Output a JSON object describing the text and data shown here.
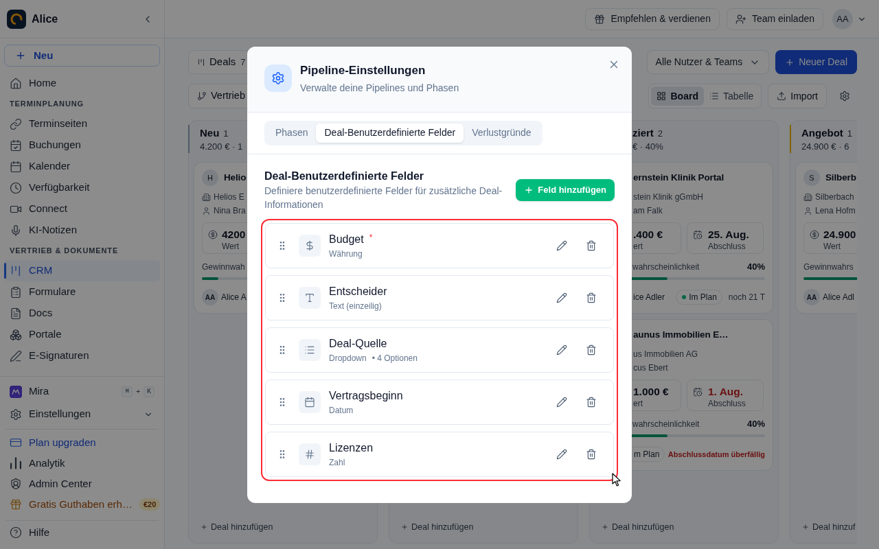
{
  "sidebar": {
    "workspace": "Alice",
    "new_button": "Neu",
    "top_items": [
      {
        "label": "Home",
        "selected": false
      }
    ],
    "sections": [
      {
        "title": "TERMINPLANUNG",
        "items": [
          {
            "label": "Terminseiten",
            "selected": false
          },
          {
            "label": "Buchungen",
            "selected": false
          },
          {
            "label": "Kalender",
            "selected": false
          },
          {
            "label": "Verfügbarkeit",
            "selected": false
          },
          {
            "label": "Connect",
            "selected": false
          },
          {
            "label": "KI-Notizen",
            "selected": false
          }
        ]
      },
      {
        "title": "VERTRIEB & DOKUMENTE",
        "items": [
          {
            "label": "CRM",
            "selected": true
          },
          {
            "label": "Formulare",
            "selected": false
          },
          {
            "label": "Docs",
            "selected": false
          },
          {
            "label": "Portale",
            "selected": false
          },
          {
            "label": "E-Signaturen",
            "selected": false
          }
        ]
      }
    ],
    "assistant": {
      "label": "Mira",
      "shortcut_keys": [
        "⌘",
        "K"
      ],
      "shortcut_joiner": "+"
    },
    "settings": {
      "label": "Einstellungen",
      "expanded": false
    },
    "footer_items": [
      {
        "kind": "upgrade",
        "label": "Plan upgraden",
        "selected": false
      },
      {
        "kind": "link",
        "label": "Analytik",
        "selected": false
      },
      {
        "kind": "link",
        "label": "Admin Center",
        "selected": false
      },
      {
        "kind": "promo",
        "label": "Gratis Guthaben erh…",
        "badge": "€20",
        "selected": false
      }
    ],
    "help": "Hilfe"
  },
  "topbar": {
    "buttons": [
      "Empfehlen & verdienen",
      "Team einladen"
    ],
    "avatar": "AA"
  },
  "toolbar": {
    "view": {
      "label": "Deals",
      "count": "7"
    },
    "pipeline": "Vertrieb",
    "owner_filter": "Alle Nutzer & Teams",
    "new_deal": "Neuer Deal",
    "view_modes": [
      {
        "label": "Board",
        "selected": true
      },
      {
        "label": "Tabelle",
        "selected": false
      }
    ],
    "import": "Import"
  },
  "board": {
    "columns": [
      {
        "title": "Neu",
        "count": "1",
        "summary": "4.200 € · 1",
        "color": "#515a65",
        "cards": [
          {
            "avatar": "H",
            "title": "Helio",
            "company": "Helios E",
            "contact": "Nina Bra",
            "value": "4200",
            "value_label": "Wert",
            "probability_label": "Gewinnwah",
            "level": 0.1,
            "owner_initials": "AA",
            "owner": "Alice A"
          }
        ],
        "add_label": "Deal hinzufügen"
      },
      {
        "add_label": "Deal hinzufügen"
      },
      {
        "title": "ziert",
        "count": "2",
        "summary": "€ · 40%",
        "cards": [
          {
            "title": "ernstein Klinik Portal",
            "company": "stein Klinik gGmbH",
            "contact": "am Falk",
            "value": ".400 €",
            "value_label": "ert",
            "date": {
              "value": "25. Aug.",
              "label": "Abschluss",
              "overdue": false
            },
            "probability_label": "wahrscheinlichkeit",
            "probability": "40%",
            "level": 0.4,
            "owner": "ice Adler",
            "status": {
              "label": "Im Plan",
              "color": "#096647"
            },
            "note": {
              "text": "noch 21 T",
              "overdue": false
            }
          },
          {
            "title": "aunus Immobilien E…",
            "company": "us Immobilien AG",
            "contact": "cus Ebert",
            "value": "1.000 €",
            "value_label": "ert",
            "date": {
              "value": "1. Aug.",
              "label": "Abschluss",
              "overdue": true
            },
            "probability_label": "wahrscheinlichkeit",
            "probability": "40%",
            "level": 0.4,
            "status": {
              "label": "m Plan"
            },
            "note": {
              "text": "Abschlussdatum überfällig",
              "overdue": true
            }
          }
        ],
        "add_label": "Deal hinzufügen"
      },
      {
        "title": "Angebot",
        "count": "1",
        "summary": "24.900 € · 6",
        "color": "#816304",
        "cards": [
          {
            "avatar": "S",
            "title": "Silberb",
            "company": "Silberbach",
            "contact": "Lena Hofm",
            "value": "24.900",
            "value_label": "Wert",
            "probability_label": "Gewinnwahrs",
            "owner_initials": "AA",
            "owner": "Alice Adl"
          }
        ],
        "add_label": "Deal hinzuf"
      }
    ]
  },
  "modal": {
    "title": "Pipeline-Einstellungen",
    "subtitle": "Verwalte deine Pipelines und Phasen",
    "tabs": [
      {
        "label": "Phasen",
        "selected": false
      },
      {
        "label": "Deal-Benutzerdefinierte Felder",
        "selected": true
      },
      {
        "label": "Verlustgründe",
        "selected": false
      }
    ],
    "section_title": "Deal-Benutzerdefinierte Felder",
    "section_description": "Definiere benutzerdefinierte Felder für zusätzliche Deal-Informationen",
    "add_button": "Feld hinzufügen",
    "required_mark": "*",
    "list_highlighted": true,
    "fields": [
      {
        "kind": "currency",
        "name": "Budget",
        "required": true,
        "type_label": "Währung"
      },
      {
        "kind": "text",
        "name": "Entscheider",
        "required": false,
        "type_label": "Text (einzeilig)"
      },
      {
        "kind": "dropdown",
        "name": "Deal-Quelle",
        "required": false,
        "type_label": "Dropdown",
        "detail": "• 4 Optionen"
      },
      {
        "kind": "date",
        "name": "Vertragsbeginn",
        "required": false,
        "type_label": "Datum"
      },
      {
        "kind": "number",
        "name": "Lizenzen",
        "required": false,
        "type_label": "Zahl"
      }
    ]
  }
}
